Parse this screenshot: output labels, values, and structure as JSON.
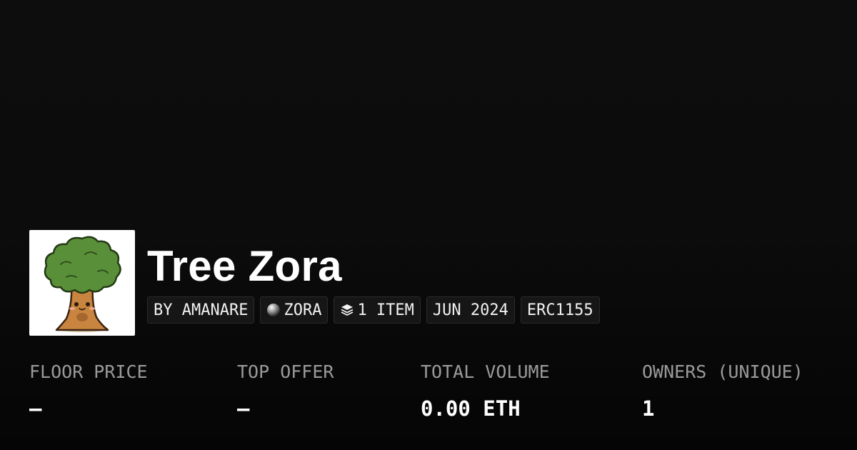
{
  "collection": {
    "title": "Tree Zora",
    "thumbnail_icon": "tree-character-icon"
  },
  "tags": {
    "creator": "BY AMANARE",
    "chain": "ZORA",
    "chain_icon": "zora-orb-icon",
    "items": "1 ITEM",
    "items_icon": "layers-icon",
    "date": "JUN 2024",
    "standard": "ERC1155"
  },
  "stats": {
    "floor_price_label": "FLOOR PRICE",
    "floor_price_value": "–",
    "top_offer_label": "TOP OFFER",
    "top_offer_value": "–",
    "total_volume_label": "TOTAL VOLUME",
    "total_volume_value": "0.00 ETH",
    "owners_label": "OWNERS (UNIQUE)",
    "owners_value": "1"
  },
  "colors": {
    "background": "#0c0c0c",
    "text": "#ffffff",
    "muted_label": "#9a9a9a",
    "tag_background": "#161616",
    "tag_border": "#2a2a2a"
  }
}
